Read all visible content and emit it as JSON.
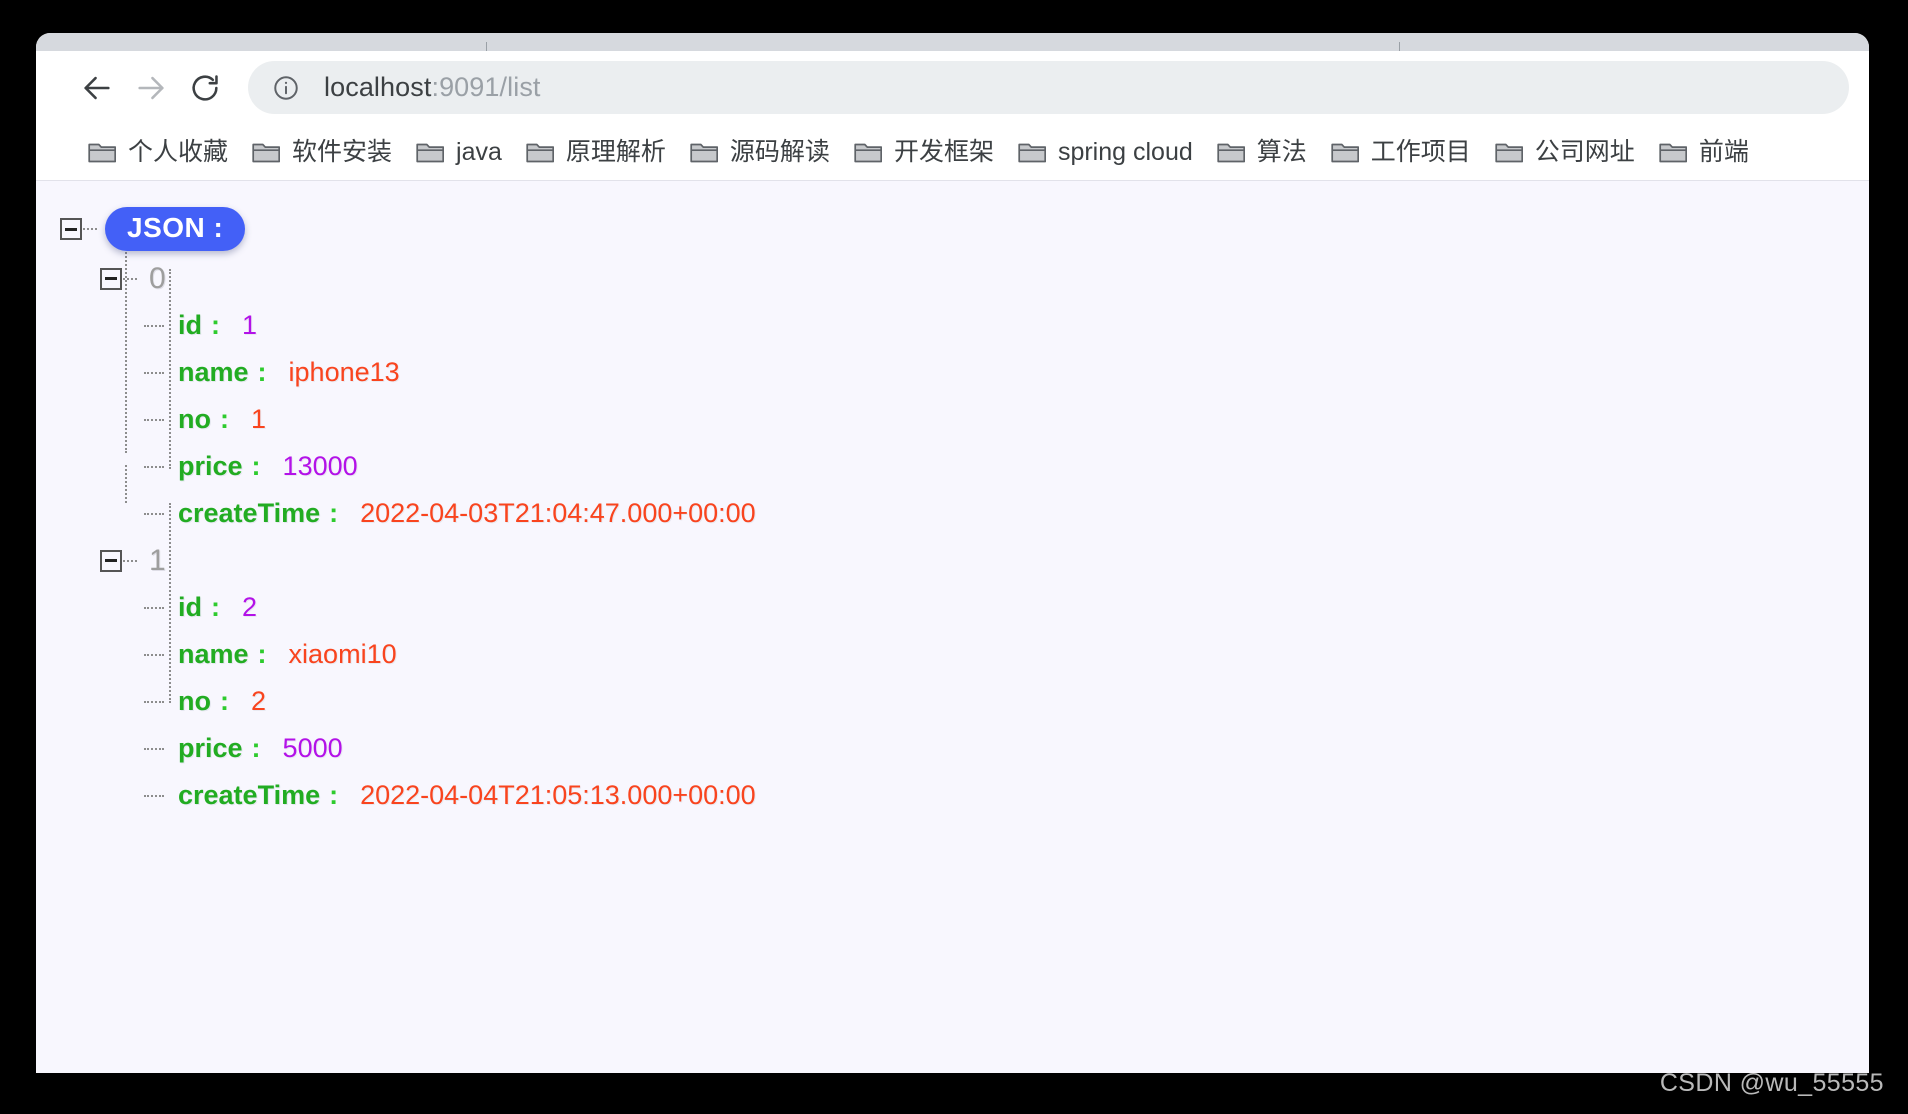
{
  "browser": {
    "nav": {
      "back_icon": "arrow-left-icon",
      "forward_icon": "arrow-right-icon",
      "reload_icon": "reload-icon"
    },
    "omnibox": {
      "info_icon": "info-circle-icon",
      "url_host": "localhost",
      "url_path": ":9091/list",
      "url_full": "localhost:9091/list"
    },
    "bookmarks": [
      {
        "label": "个人收藏",
        "icon": "folder-icon"
      },
      {
        "label": "软件安装",
        "icon": "folder-icon"
      },
      {
        "label": "java",
        "icon": "folder-icon"
      },
      {
        "label": "原理解析",
        "icon": "folder-icon"
      },
      {
        "label": "源码解读",
        "icon": "folder-icon"
      },
      {
        "label": "开发框架",
        "icon": "folder-icon"
      },
      {
        "label": "spring cloud",
        "icon": "folder-icon"
      },
      {
        "label": "算法",
        "icon": "folder-icon"
      },
      {
        "label": "工作项目",
        "icon": "folder-icon"
      },
      {
        "label": "公司网址",
        "icon": "folder-icon"
      },
      {
        "label": "前端",
        "icon": "folder-icon"
      }
    ]
  },
  "viewer": {
    "root_label": "JSON :",
    "badge_color": "#4360f7",
    "key_color": "#22ac22",
    "number_color": "#b312e8",
    "string_color": "#f9441e",
    "background": "#f8f7fe",
    "nodes": [
      {
        "index": "0",
        "fields": [
          {
            "key": "id",
            "colon": ":",
            "value": "1",
            "type": "number"
          },
          {
            "key": "name",
            "colon": ":",
            "value": "iphone13",
            "type": "string"
          },
          {
            "key": "no",
            "colon": ":",
            "value": "1",
            "type": "string"
          },
          {
            "key": "price",
            "colon": ":",
            "value": "13000",
            "type": "number"
          },
          {
            "key": "createTime",
            "colon": ":",
            "value": "2022-04-03T21:04:47.000+00:00",
            "type": "string"
          }
        ]
      },
      {
        "index": "1",
        "fields": [
          {
            "key": "id",
            "colon": ":",
            "value": "2",
            "type": "number"
          },
          {
            "key": "name",
            "colon": ":",
            "value": "xiaomi10",
            "type": "string"
          },
          {
            "key": "no",
            "colon": ":",
            "value": "2",
            "type": "string"
          },
          {
            "key": "price",
            "colon": ":",
            "value": "5000",
            "type": "number"
          },
          {
            "key": "createTime",
            "colon": ":",
            "value": "2022-04-04T21:05:13.000+00:00",
            "type": "string"
          }
        ]
      }
    ]
  },
  "watermark": {
    "text": "CSDN @wu_55555"
  }
}
